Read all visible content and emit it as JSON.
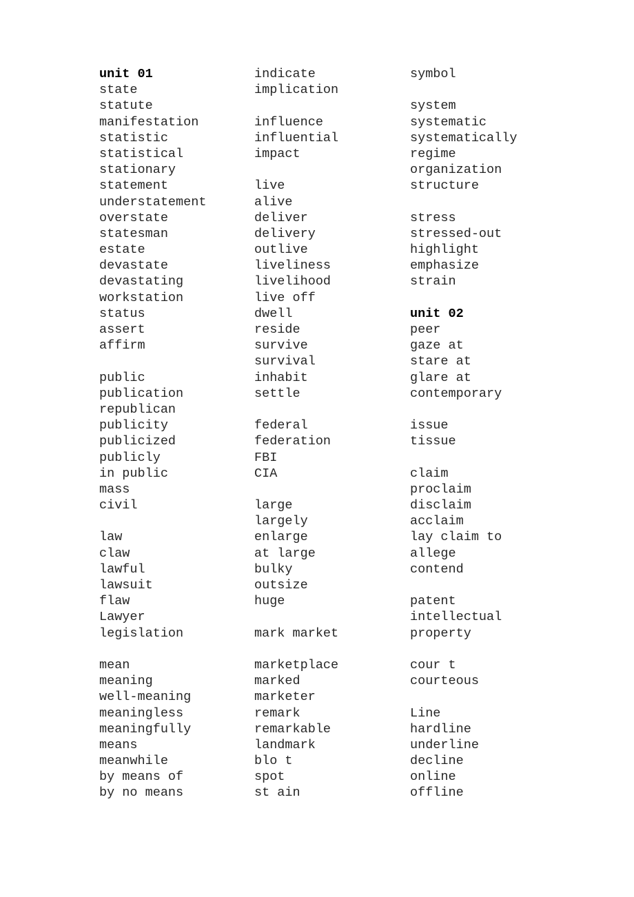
{
  "document": {
    "type": "vocabulary-word-list",
    "page_background": "#ffffff",
    "text_color": "#262626",
    "heading_color": "#000000",
    "columns": [
      {
        "id": "column-1",
        "rows": [
          "unit 01",
          "state",
          "statute",
          "manifestation",
          "statistic",
          "statistical",
          "stationary",
          "statement",
          "understatement",
          "overstate",
          "statesman",
          "estate",
          "devastate",
          "devastating",
          "workstation",
          "status",
          "assert",
          "affirm",
          "",
          "public",
          "publication",
          "republican",
          "publicity",
          "publicized",
          "publicly",
          "in public",
          "mass",
          "civil",
          "",
          "law",
          "claw",
          "lawful",
          "lawsuit",
          "flaw",
          "Lawyer",
          "legislation",
          "",
          "mean",
          "meaning",
          "well-meaning",
          "meaningless",
          "meaningfully",
          "means",
          "meanwhile",
          "by means of",
          "by no means"
        ],
        "headings": [
          "unit 01"
        ]
      },
      {
        "id": "column-2",
        "rows": [
          "indicate",
          "implication",
          "",
          "influence",
          "influential",
          "impact",
          "",
          "live",
          "alive",
          "deliver",
          "delivery",
          "outlive",
          "liveliness",
          "livelihood",
          "live off",
          "dwell",
          "reside",
          "survive",
          "survival",
          "inhabit",
          "settle",
          "",
          "federal",
          "federation",
          "FBI",
          "CIA",
          "",
          "large",
          "largely",
          "enlarge",
          "at large",
          "bulky",
          "outsize",
          "huge",
          "",
          "mark market",
          "",
          "marketplace",
          "marked",
          "marketer",
          "remark",
          "remarkable",
          "landmark",
          "blo t",
          "spot",
          "st ain"
        ],
        "headings": []
      },
      {
        "id": "column-3",
        "rows": [
          "symbol",
          "",
          "system",
          "systematic",
          "systematically",
          "regime",
          "organization",
          "structure",
          "",
          "stress",
          "stressed-out",
          "highlight",
          "emphasize",
          "strain",
          "",
          "unit 02",
          "peer",
          "gaze at",
          "stare at",
          "glare at",
          "contemporary",
          "",
          "issue",
          "tissue",
          "",
          "claim",
          "proclaim",
          "disclaim",
          "acclaim",
          "lay claim to",
          "allege",
          "contend",
          "",
          "patent",
          "intellectual",
          "property",
          "",
          "cour t",
          "courteous",
          "",
          "Line",
          "hardline",
          "underline",
          "decline",
          "online",
          "offline"
        ],
        "headings": [
          "unit 02"
        ]
      }
    ]
  }
}
